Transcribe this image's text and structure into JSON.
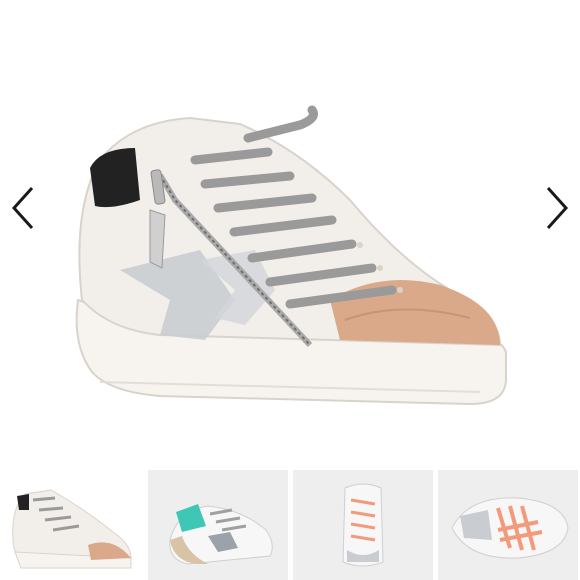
{
  "gallery": {
    "previous": {
      "icon": "chevron-left-icon"
    },
    "next": {
      "icon": "chevron-right-icon"
    },
    "thumbnails": [
      {
        "name": "thumbnail-1",
        "background": "#ffffff"
      },
      {
        "name": "thumbnail-2",
        "background": "#eeeeee"
      },
      {
        "name": "thumbnail-3",
        "background": "#eeeeee"
      },
      {
        "name": "thumbnail-4",
        "background": "#eeeeee"
      }
    ]
  },
  "colors": {
    "arrow": "#1a1a1a",
    "leather": "#f2efea",
    "sole": "#f7f4ef",
    "metallic_toe": "#d9a98a",
    "heel_tab": "#222222",
    "laces": "#9a9a9a",
    "silver": "#c9cdd1",
    "accent_teal": "#3fc7b6",
    "accent_coral": "#f39a7b"
  }
}
